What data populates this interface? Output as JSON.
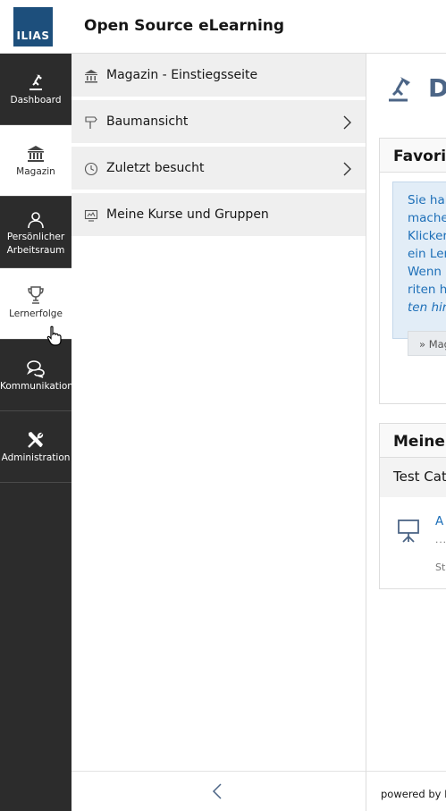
{
  "header": {
    "logo_text": "ILIAS",
    "title": "Open Source eLearning"
  },
  "mainbar": {
    "items": [
      {
        "label": "Dashboard",
        "icon": "dashboard-icon"
      },
      {
        "label": "Magazin",
        "icon": "museum-icon"
      },
      {
        "label_line1": "Persönlicher",
        "label_line2": "Arbeitsraum",
        "icon": "user-icon"
      },
      {
        "label": "Lernerfolge",
        "icon": "trophy-icon"
      },
      {
        "label": "Kommunikation",
        "icon": "chat-bubbles-icon"
      },
      {
        "label": "Administration",
        "icon": "tools-icon"
      }
    ]
  },
  "slate": {
    "items": [
      {
        "label": "Magazin - Einstiegsseite",
        "icon": "museum-icon"
      },
      {
        "label": "Baumansicht",
        "icon": "signpost-icon"
      },
      {
        "label": "Zuletzt besucht",
        "icon": "clock-icon"
      },
      {
        "label": "Meine Kurse und Gruppen",
        "icon": "screen-icon"
      }
    ]
  },
  "content": {
    "page_title": "D",
    "favorites": {
      "title": "Favorit",
      "info_lines": [
        "Sie hab",
        "mache",
        "Klicker",
        "ein Ler",
        "Wenn S",
        "riten h"
      ],
      "info_italic": "ten hin",
      "button": "» Mag"
    },
    "courses": {
      "title": "Meine",
      "category": "Test Cat",
      "item_title": "A",
      "item_dots": "...",
      "item_status": "Sta"
    },
    "footer": "powered by I"
  },
  "colors": {
    "mainbar_bg": "#2c2c2c",
    "logo_bg": "#1d4f7c",
    "accent_link": "#1d6fb8",
    "info_bg": "#e2edf7",
    "title_blue": "#4c6586"
  }
}
